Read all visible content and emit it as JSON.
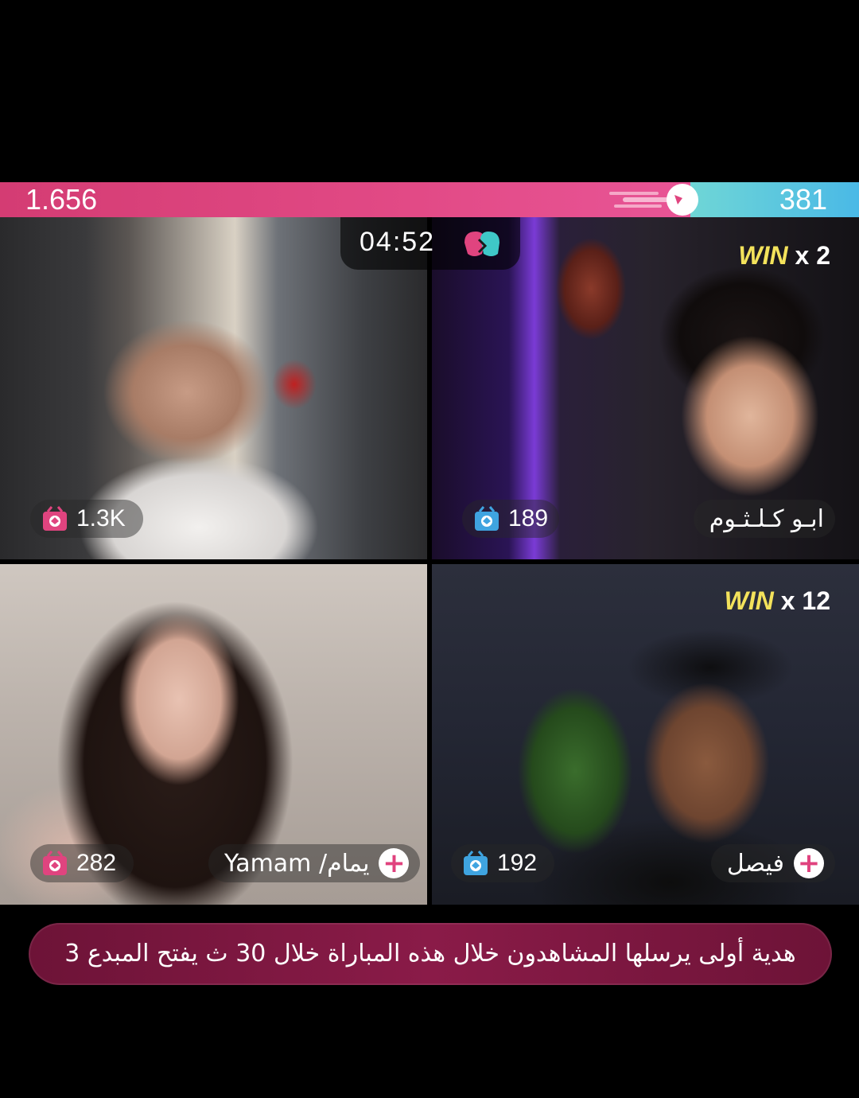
{
  "score": {
    "left": "1.656",
    "right": "381",
    "left_color": "#e0447f",
    "right_color": "#55c6e2"
  },
  "timer": {
    "value": "04:52",
    "icon": "boxing-gloves-icon"
  },
  "tiles": [
    {
      "gifts": "1.3K",
      "gift_color": "#e0447f"
    },
    {
      "gifts": "189",
      "gift_color": "#3fa4e0",
      "win_label": "WIN",
      "win_count": "x 2",
      "name": "ابـو كـلـثـوم"
    },
    {
      "gifts": "282",
      "gift_color": "#e0447f",
      "name": "Yamam /يمام"
    },
    {
      "gifts": "192",
      "gift_color": "#3fa4e0",
      "win_label": "WIN",
      "win_count": "x 12",
      "name": "فيصل"
    }
  ],
  "banner": {
    "text": "هدية أولى يرسلها المشاهدون خلال هذه المباراة خلال 30 ث    يفتح المبدع 3"
  },
  "win_color": "#f3e25b"
}
